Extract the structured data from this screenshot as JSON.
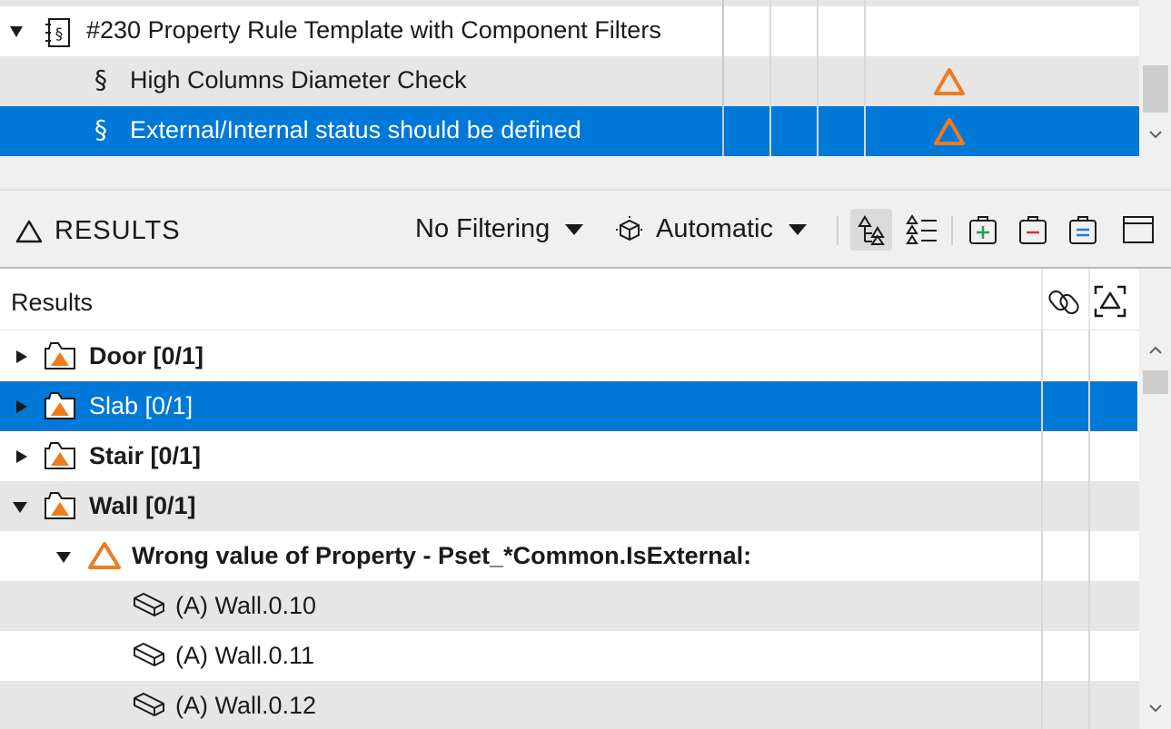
{
  "rules": {
    "items": [
      {
        "label": "#230 Property Rule Template with Component Filters",
        "icon": "ruleset-icon",
        "expanded": true,
        "warning": false
      },
      {
        "label": "High Columns Diameter Check",
        "icon": "section-icon",
        "warning": true
      },
      {
        "label": "External/Internal status should be defined",
        "icon": "section-icon",
        "warning": true,
        "selected": true
      }
    ],
    "section_symbol": "§"
  },
  "toolbar": {
    "title": "RESULTS",
    "filter_label": "No Filtering",
    "mode_label": "Automatic",
    "buttons": [
      "tree-view-icon",
      "list-view-icon",
      "add-to-issue-icon",
      "remove-from-issue-icon",
      "issue-details-icon",
      "window-icon"
    ]
  },
  "results": {
    "header": "Results",
    "header_icons": [
      "link-icon",
      "isolate-icon"
    ],
    "rows": [
      {
        "label": "Door [0/1]",
        "bold": true,
        "expanded": false,
        "level": 0
      },
      {
        "label": "Slab [0/1]",
        "bold": false,
        "expanded": false,
        "level": 0,
        "selected": true
      },
      {
        "label": "Stair [0/1]",
        "bold": true,
        "expanded": false,
        "level": 0
      },
      {
        "label": "Wall [0/1]",
        "bold": true,
        "expanded": true,
        "level": 0
      },
      {
        "label": "Wrong value of Property - Pset_*Common.IsExternal:",
        "bold": true,
        "expanded": true,
        "level": 1
      },
      {
        "label": "(A) Wall.0.10",
        "level": 2
      },
      {
        "label": "(A) Wall.0.11",
        "level": 2
      },
      {
        "label": "(A) Wall.0.12",
        "level": 2
      }
    ]
  },
  "colors": {
    "selection": "#0078d7",
    "warning": "#f07b1e",
    "row_alt": "#e6e6e6",
    "add": "#1fa34a",
    "remove": "#d32f2f",
    "details": "#1e7ad6"
  }
}
